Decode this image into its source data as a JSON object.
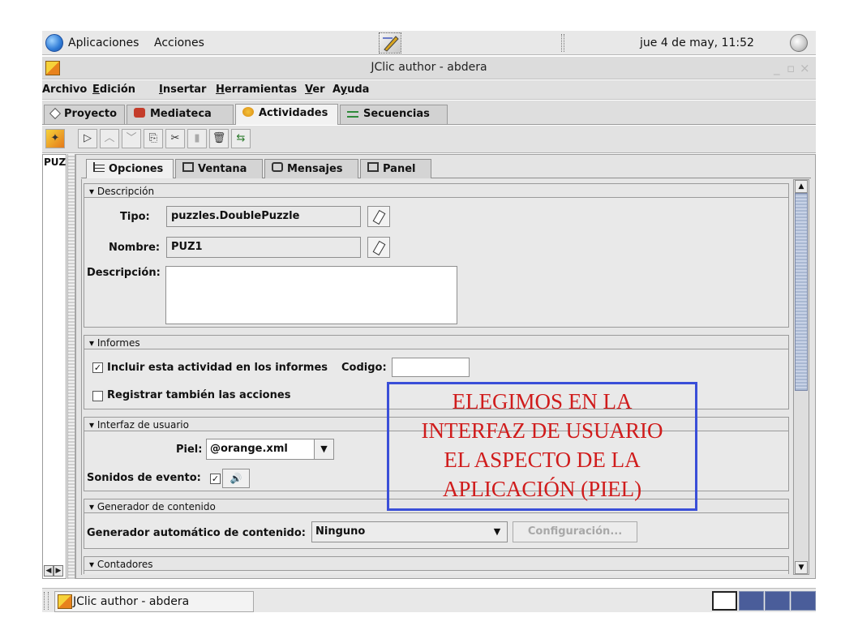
{
  "panel": {
    "menus": [
      "Aplicaciones",
      "Acciones"
    ],
    "clock": "jue  4 de may, 11:52"
  },
  "window": {
    "title": "JClic author - abdera",
    "controls": [
      "_",
      "▫",
      "×"
    ]
  },
  "menubar": [
    {
      "label": "Archivo",
      "hotkey": ""
    },
    {
      "label": "Edición",
      "hotkey": "E"
    },
    {
      "label": "Insertar",
      "hotkey": "I"
    },
    {
      "label": "Herramientas",
      "hotkey": "H"
    },
    {
      "label": "Ver",
      "hotkey": "V"
    },
    {
      "label": "Ayuda",
      "hotkey": "y"
    }
  ],
  "tabs": [
    "Proyecto",
    "Mediateca",
    "Actividades",
    "Secuencias"
  ],
  "active_tab": "Actividades",
  "toolbar": {
    "icons": [
      "new-activity-icon",
      "play-icon",
      "move-up-icon",
      "move-down-icon",
      "copy-icon",
      "cut-icon",
      "paste-icon",
      "delete-icon",
      "random-icon"
    ],
    "glyphs": [
      "✦",
      "▷",
      "︿",
      "﹀",
      "⎘",
      "✂",
      "▮",
      "🗑",
      "⇆"
    ]
  },
  "left_list": {
    "item": "PUZ"
  },
  "inner_tabs": [
    "Opciones",
    "Ventana",
    "Mensajes",
    "Panel"
  ],
  "active_inner_tab": "Opciones",
  "descripcion": {
    "header": "Descripción",
    "tipo_label": "Tipo:",
    "tipo_value": "puzzles.DoublePuzzle",
    "nombre_label": "Nombre:",
    "nombre_value": "PUZ1",
    "descripcion_label": "Descripción:",
    "descripcion_value": ""
  },
  "informes": {
    "header": "Informes",
    "incluir_label": "Incluir esta actividad en los informes",
    "incluir_checked": true,
    "codigo_label": "Codigo:",
    "codigo_value": "",
    "registrar_label": "Registrar también las acciones",
    "registrar_checked": false
  },
  "interfaz": {
    "header": "Interfaz de usuario",
    "piel_label": "Piel:",
    "piel_value": "@orange.xml",
    "sonidos_label": "Sonidos de evento:",
    "sonidos_checked": true
  },
  "generador": {
    "header": "Generador de contenido",
    "auto_label": "Generador automático de contenido:",
    "auto_value": "Ninguno",
    "config_button": "Configuración..."
  },
  "contadores": {
    "header": "Contadores"
  },
  "annotation": {
    "lines": [
      "ELEGIMOS EN LA",
      "INTERFAZ DE USUARIO",
      "EL ASPECTO DE LA",
      "APLICACIÓN (PIEL)"
    ],
    "border_color": "#3a4fd8",
    "text_color": "#d01c1c"
  },
  "taskbar": {
    "item": "JClic author - abdera"
  },
  "colors": {
    "accent": "#3a4fd8"
  }
}
